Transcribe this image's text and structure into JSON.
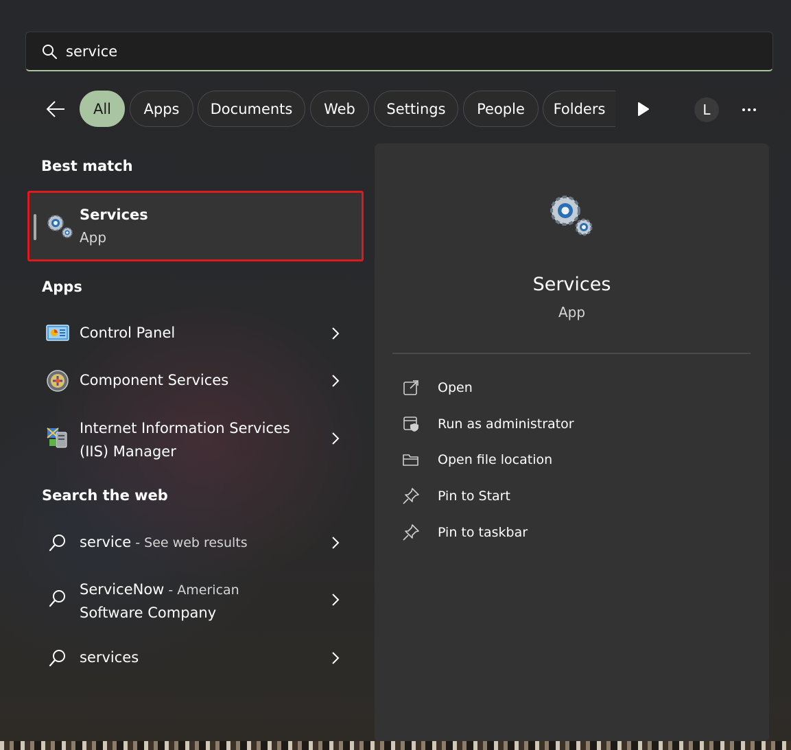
{
  "search": {
    "value": "service",
    "placeholder": ""
  },
  "filters": {
    "tabs": [
      {
        "label": "All",
        "active": true
      },
      {
        "label": "Apps"
      },
      {
        "label": "Documents"
      },
      {
        "label": "Web"
      },
      {
        "label": "Settings"
      },
      {
        "label": "People"
      },
      {
        "label": "Folders"
      }
    ],
    "avatar_letter": "L"
  },
  "best_match": {
    "title": "Best match",
    "name": "Services",
    "type": "App"
  },
  "apps": {
    "title": "Apps",
    "items": [
      {
        "name": "Control Panel",
        "icon": "control-panel-icon"
      },
      {
        "name": "Component Services",
        "icon": "component-services-icon"
      },
      {
        "name_line1": "Internet Information Services",
        "name_line2": "(IIS) Manager",
        "icon": "iis-manager-icon"
      }
    ]
  },
  "web": {
    "title": "Search the web",
    "items": [
      {
        "query": "service",
        "suffix": " - See web results"
      },
      {
        "query": "ServiceNow",
        "suffix": " - American",
        "line2": "Software Company"
      },
      {
        "query": "services"
      }
    ]
  },
  "detail": {
    "name": "Services",
    "type": "App",
    "actions": [
      {
        "label": "Open",
        "icon": "open-external-icon"
      },
      {
        "label": "Run as administrator",
        "icon": "shield-admin-icon"
      },
      {
        "label": "Open file location",
        "icon": "folder-icon"
      },
      {
        "label": "Pin to Start",
        "icon": "pin-icon"
      },
      {
        "label": "Pin to taskbar",
        "icon": "pin-icon"
      }
    ]
  },
  "colors": {
    "accent": "#a9c4a0",
    "highlight_border": "#e0191c",
    "panel": "#333333"
  }
}
